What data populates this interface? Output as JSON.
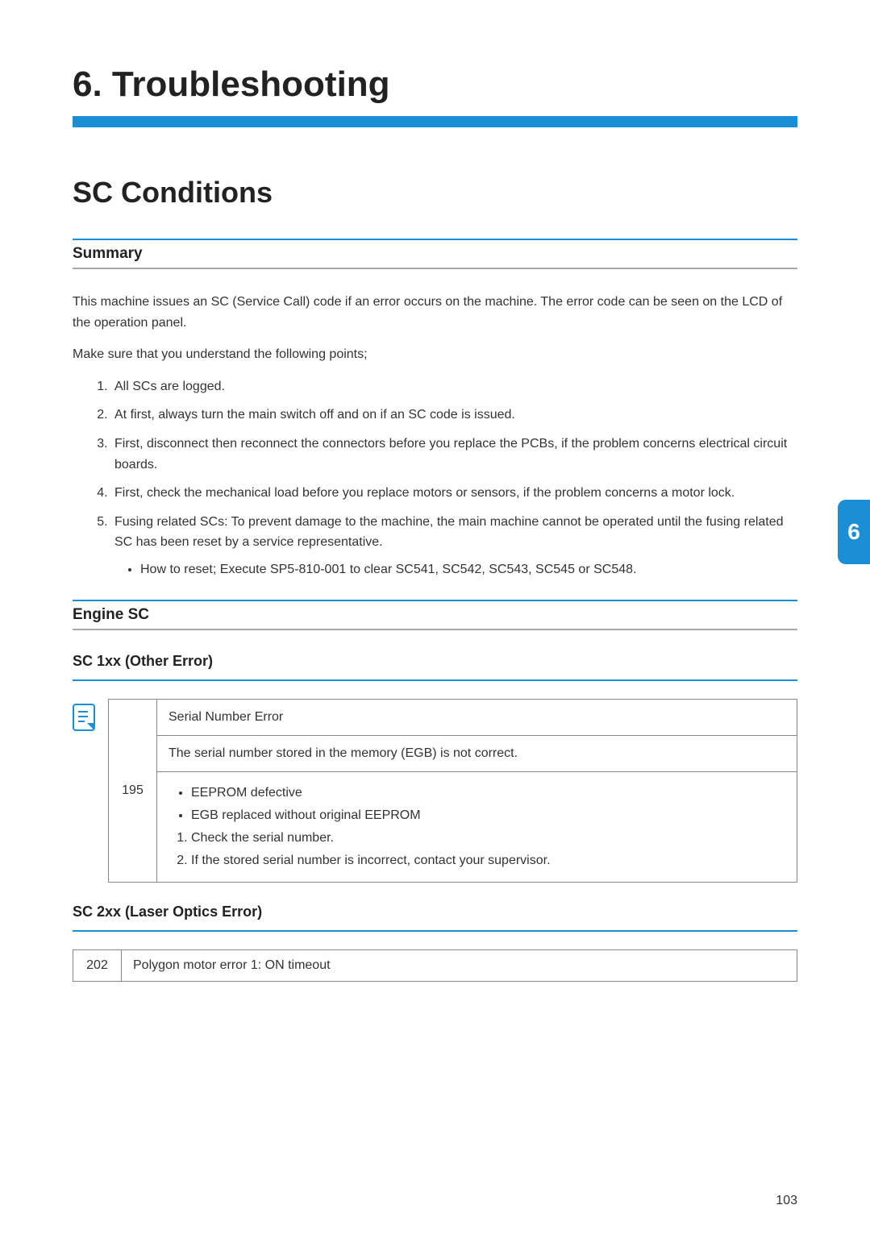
{
  "chapter": {
    "title": "6. Troubleshooting"
  },
  "section": {
    "title": "SC Conditions"
  },
  "summary": {
    "heading": "Summary",
    "p1": "This machine issues an SC (Service Call) code if an error occurs on the machine. The error code can be seen on the LCD of the operation panel.",
    "p2": "Make sure that you understand the following points;",
    "list": {
      "i1": "All SCs are logged.",
      "i2": "At first, always turn the main switch off and on if an SC code is issued.",
      "i3": "First, disconnect then reconnect the connectors before you replace the PCBs, if the problem concerns electrical circuit boards.",
      "i4": "First, check the mechanical load before you replace motors or sensors, if the problem concerns a motor lock.",
      "i5": "Fusing related SCs: To prevent damage to the machine, the main machine cannot be operated until the fusing related SC has been reset by a service representative.",
      "i5_sub": "How to reset; Execute SP5-810-001 to clear SC541, SC542, SC543, SC545 or SC548."
    }
  },
  "engine_sc": {
    "heading": "Engine SC"
  },
  "sc1xx": {
    "heading": "SC 1xx (Other Error)",
    "icon_name": "note-icon",
    "code": "195",
    "row_title": "Serial Number Error",
    "row_desc": "The serial number stored in the memory (EGB) is not correct.",
    "bul1": "EEPROM defective",
    "bul2": "EGB replaced without original EEPROM",
    "step1": "Check the serial number.",
    "step2": "If the stored serial number is incorrect, contact your supervisor."
  },
  "sc2xx": {
    "heading": "SC 2xx (Laser Optics Error)",
    "code": "202",
    "row_title": "Polygon motor error 1: ON timeout"
  },
  "tab": {
    "label": "6"
  },
  "footer": {
    "page": "103"
  }
}
